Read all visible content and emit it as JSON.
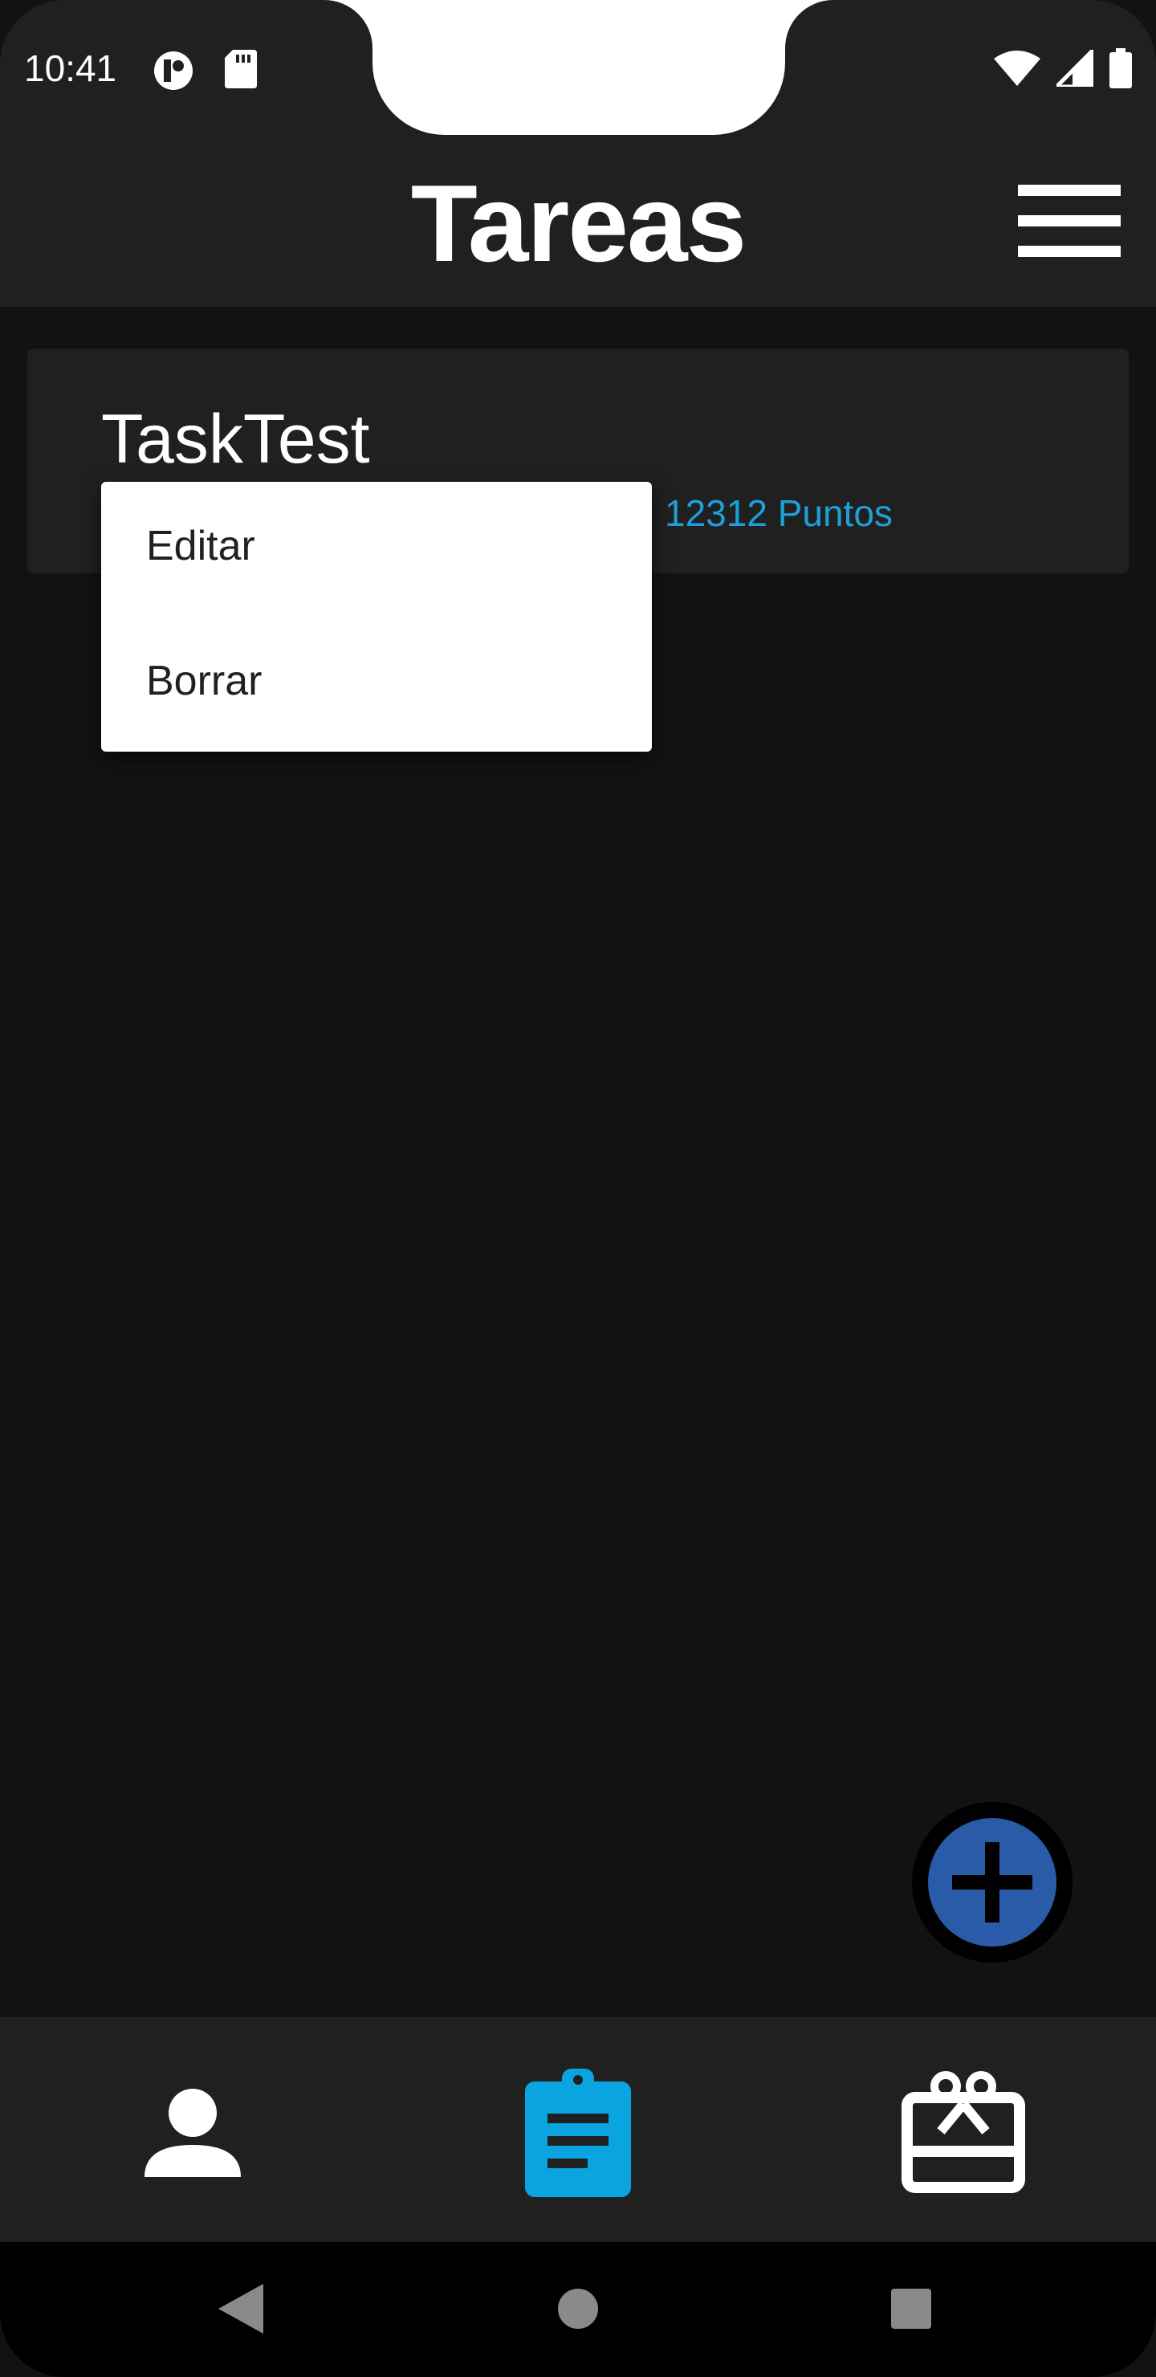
{
  "status_bar": {
    "time": "10:41",
    "icons_left": [
      "data-saver-icon",
      "sd-card-icon"
    ],
    "icons_right": [
      "wifi-icon",
      "signal-icon",
      "battery-icon"
    ]
  },
  "app_bar": {
    "title": "Tareas",
    "menu_icon": "hamburger-menu-icon"
  },
  "task": {
    "title": "TaskTest",
    "points": "12312 Puntos",
    "points_color": "#1e9fd9"
  },
  "context_menu": {
    "items": [
      {
        "label": "Editar"
      },
      {
        "label": "Borrar"
      }
    ]
  },
  "fab": {
    "icon": "plus-icon",
    "color": "#2a5ba8"
  },
  "bottom_nav": {
    "items": [
      {
        "icon": "person-icon",
        "active": false
      },
      {
        "icon": "clipboard-icon",
        "active": true
      },
      {
        "icon": "gift-card-icon",
        "active": false
      }
    ],
    "active_color": "#0aa5e0"
  },
  "system_nav": {
    "icons": [
      "back-icon",
      "home-icon",
      "recents-icon"
    ]
  }
}
